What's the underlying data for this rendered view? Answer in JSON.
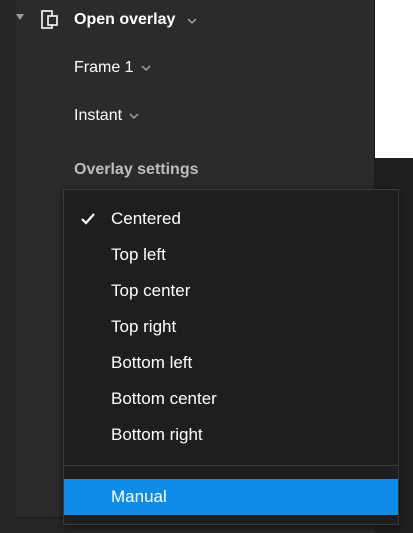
{
  "action": {
    "label": "Open overlay",
    "icon": "open-overlay-icon"
  },
  "destination": {
    "label": "Frame 1"
  },
  "animation": {
    "label": "Instant"
  },
  "overlay_settings": {
    "title": "Overlay settings"
  },
  "position_menu": {
    "checked": "Centered",
    "highlighted": "Manual",
    "options": [
      "Centered",
      "Top left",
      "Top center",
      "Top right",
      "Bottom left",
      "Bottom center",
      "Bottom right",
      "Manual"
    ]
  },
  "colors": {
    "panel": "#2b2b2b",
    "menu": "#1e1e1e",
    "highlight": "#0d8ce9",
    "text": "#ffffff"
  }
}
